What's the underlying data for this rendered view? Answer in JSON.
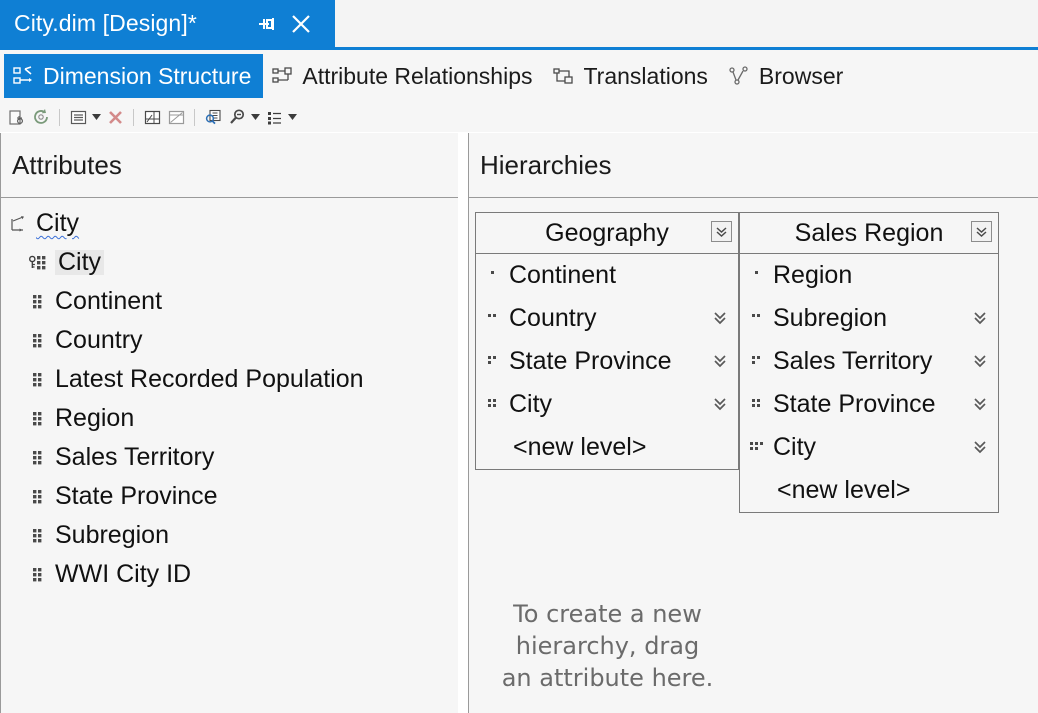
{
  "window": {
    "document_tab_title": "City.dim [Design]*",
    "pin_icon": "pin-icon",
    "close_icon": "close-icon",
    "accent_color": "#0f7fd4"
  },
  "view_tabs": [
    {
      "label": "Dimension Structure",
      "icon": "dimension-structure-icon",
      "active": true
    },
    {
      "label": "Attribute Relationships",
      "icon": "attribute-relationships-icon",
      "active": false
    },
    {
      "label": "Translations",
      "icon": "translations-icon",
      "active": false
    },
    {
      "label": "Browser",
      "icon": "browser-icon",
      "active": false
    }
  ],
  "toolbar": {
    "buttons": [
      {
        "name": "new-attribute-icon"
      },
      {
        "name": "refresh-icon"
      },
      {
        "name": "show-attributes-list-icon"
      },
      {
        "name": "delete-icon"
      },
      {
        "name": "show-data-source-view-icon"
      },
      {
        "name": "show-dimension-structure-icon"
      },
      {
        "name": "find-icon"
      },
      {
        "name": "zoom-icon"
      },
      {
        "name": "list-view-icon"
      }
    ]
  },
  "attributes_panel": {
    "title": "Attributes",
    "items": [
      {
        "label": "City",
        "icon": "dimension-icon",
        "level": 0,
        "key_attribute": false,
        "selected": false,
        "squiggly": true
      },
      {
        "label": "City",
        "icon": "key-attribute-icon",
        "level": 1,
        "key_attribute": true,
        "selected": true,
        "squiggly": false
      },
      {
        "label": "Continent",
        "icon": "attribute-icon",
        "level": 1,
        "key_attribute": false,
        "selected": false,
        "squiggly": false
      },
      {
        "label": "Country",
        "icon": "attribute-icon",
        "level": 1,
        "key_attribute": false,
        "selected": false,
        "squiggly": false
      },
      {
        "label": "Latest Recorded Population",
        "icon": "attribute-icon",
        "level": 1,
        "key_attribute": false,
        "selected": false,
        "squiggly": false
      },
      {
        "label": "Region",
        "icon": "attribute-icon",
        "level": 1,
        "key_attribute": false,
        "selected": false,
        "squiggly": false
      },
      {
        "label": "Sales Territory",
        "icon": "attribute-icon",
        "level": 1,
        "key_attribute": false,
        "selected": false,
        "squiggly": false
      },
      {
        "label": "State Province",
        "icon": "attribute-icon",
        "level": 1,
        "key_attribute": false,
        "selected": false,
        "squiggly": false
      },
      {
        "label": "Subregion",
        "icon": "attribute-icon",
        "level": 1,
        "key_attribute": false,
        "selected": false,
        "squiggly": false
      },
      {
        "label": "WWI City ID",
        "icon": "attribute-icon",
        "level": 1,
        "key_attribute": false,
        "selected": false,
        "squiggly": false
      }
    ]
  },
  "hierarchies_panel": {
    "title": "Hierarchies",
    "new_level_label": "<new level>",
    "collapse_icon": "chevron-double-down-icon",
    "hierarchies": [
      {
        "name": "Geography",
        "levels": [
          {
            "label": "Continent",
            "depth": 1,
            "has_chevron": false
          },
          {
            "label": "Country",
            "depth": 2,
            "has_chevron": true
          },
          {
            "label": "State Province",
            "depth": 3,
            "has_chevron": true
          },
          {
            "label": "City",
            "depth": 4,
            "has_chevron": true
          }
        ]
      },
      {
        "name": "Sales Region",
        "levels": [
          {
            "label": "Region",
            "depth": 1,
            "has_chevron": false
          },
          {
            "label": "Subregion",
            "depth": 2,
            "has_chevron": true
          },
          {
            "label": "Sales Territory",
            "depth": 3,
            "has_chevron": true
          },
          {
            "label": "State Province",
            "depth": 4,
            "has_chevron": true
          },
          {
            "label": "City",
            "depth": 5,
            "has_chevron": true
          }
        ]
      }
    ],
    "drag_hint": {
      "line1": "To create a new",
      "line2": "hierarchy, drag",
      "line3": "an attribute here."
    }
  }
}
